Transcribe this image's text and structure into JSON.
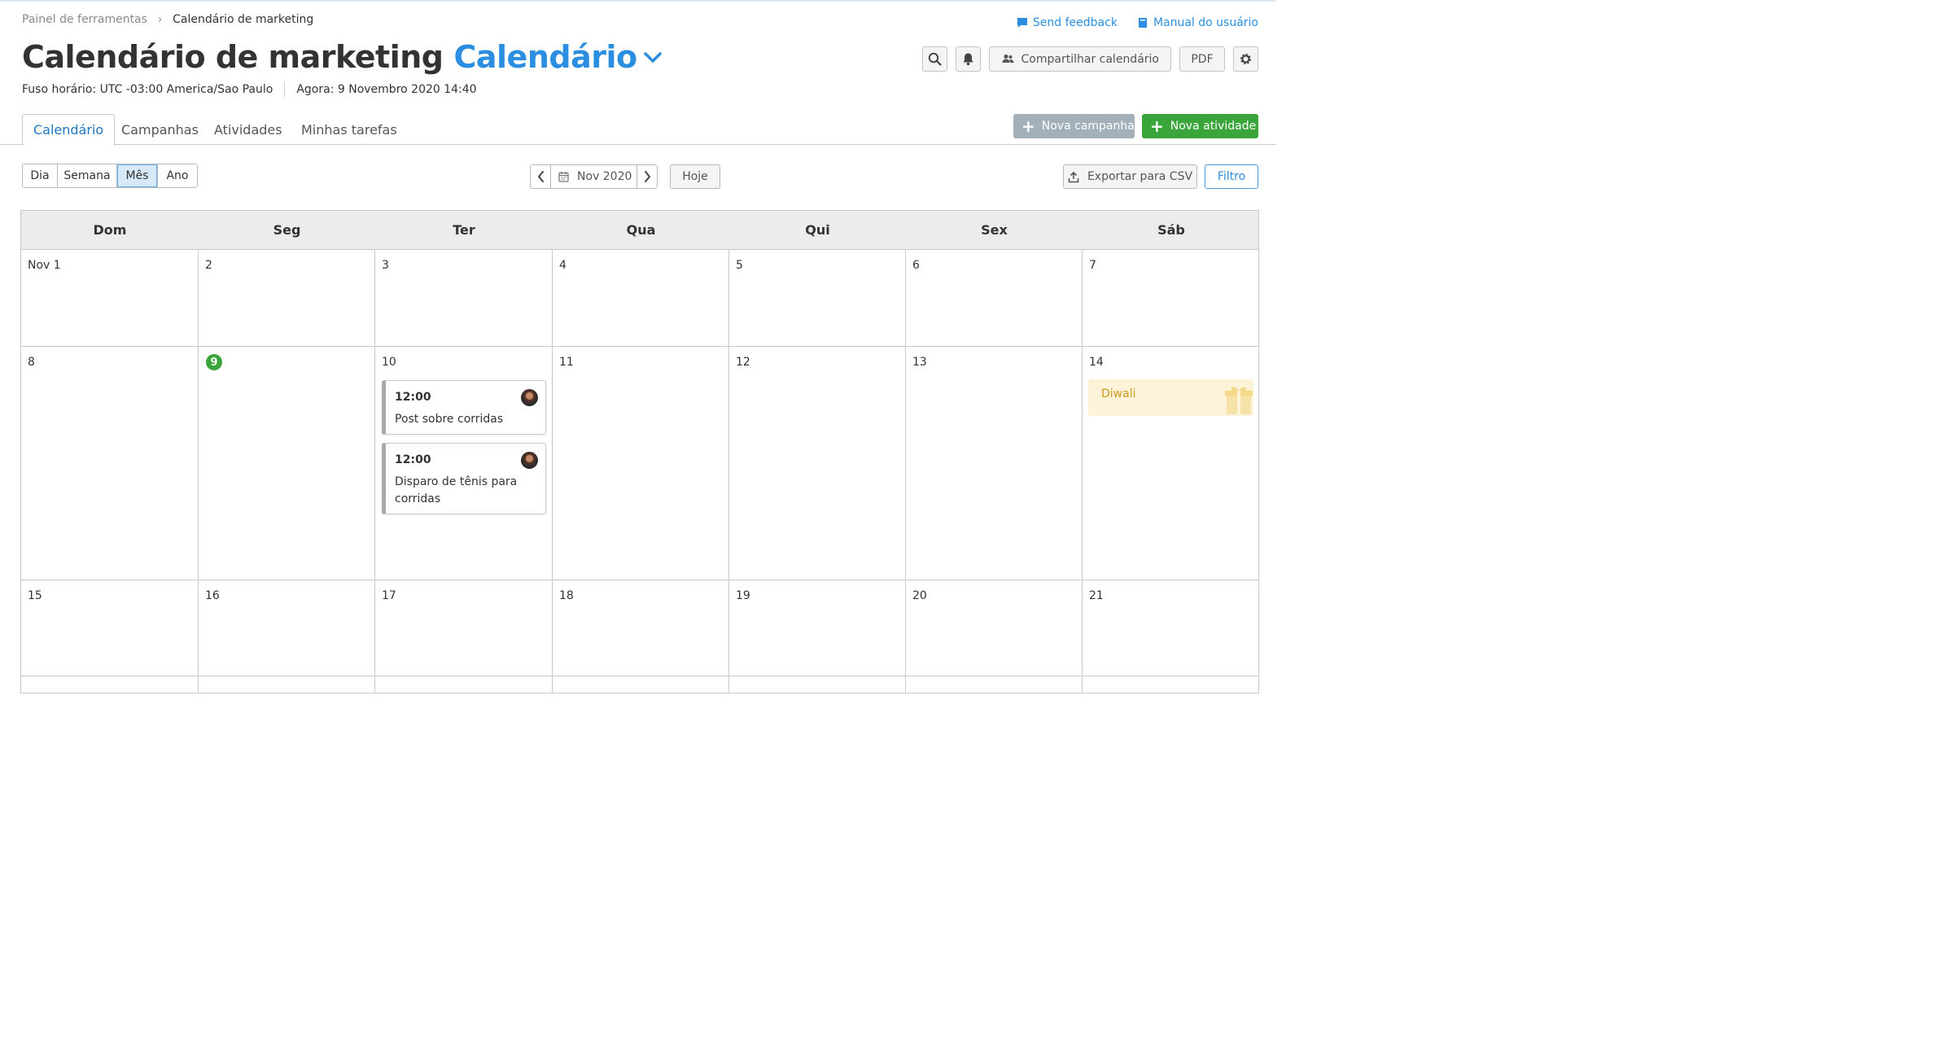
{
  "breadcrumb": {
    "parent": "Painel de ferramentas",
    "separator": "›",
    "current": "Calendário de marketing"
  },
  "top_links": {
    "feedback": "Send feedback",
    "manual": "Manual do usuário"
  },
  "header": {
    "title": "Calendário de marketing",
    "view_select": "Calendário",
    "timezone": "Fuso horário: UTC -03:00 America/Sao Paulo",
    "now": "Agora: 9 Novembro 2020 14:40"
  },
  "tools": {
    "share": "Compartilhar calendário",
    "pdf": "PDF"
  },
  "tabs": [
    "Calendário",
    "Campanhas",
    "Atividades",
    "Minhas tarefas"
  ],
  "actions": {
    "new_campaign": "Nova campanha",
    "new_activity": "Nova atividade",
    "plus": "+"
  },
  "view_modes": {
    "items": [
      "Dia",
      "Semana",
      "Mês",
      "Ano"
    ],
    "active": "Mês"
  },
  "date_nav": {
    "current": "Nov 2020",
    "today": "Hoje"
  },
  "export": {
    "csv": "Exportar para CSV",
    "filter": "Filtro"
  },
  "calendar": {
    "weekdays": [
      "Dom",
      "Seg",
      "Ter",
      "Qua",
      "Qui",
      "Sex",
      "Sáb"
    ],
    "weeks": [
      [
        "Nov 1",
        "2",
        "3",
        "4",
        "5",
        "6",
        "7"
      ],
      [
        "8",
        "9",
        "10",
        "11",
        "12",
        "13",
        "14"
      ],
      [
        "15",
        "16",
        "17",
        "18",
        "19",
        "20",
        "21"
      ]
    ],
    "today": "9",
    "events": [
      {
        "time": "12:00",
        "title": "Post sobre corridas"
      },
      {
        "time": "12:00",
        "title": "Disparo de tênis para corridas"
      }
    ],
    "holiday": {
      "name": "Diwali"
    }
  },
  "colors": {
    "accent": "#2b8ee0",
    "success": "#3aa53a",
    "holiday_bg": "#fdf3d8",
    "holiday_text": "#c99a1c"
  }
}
